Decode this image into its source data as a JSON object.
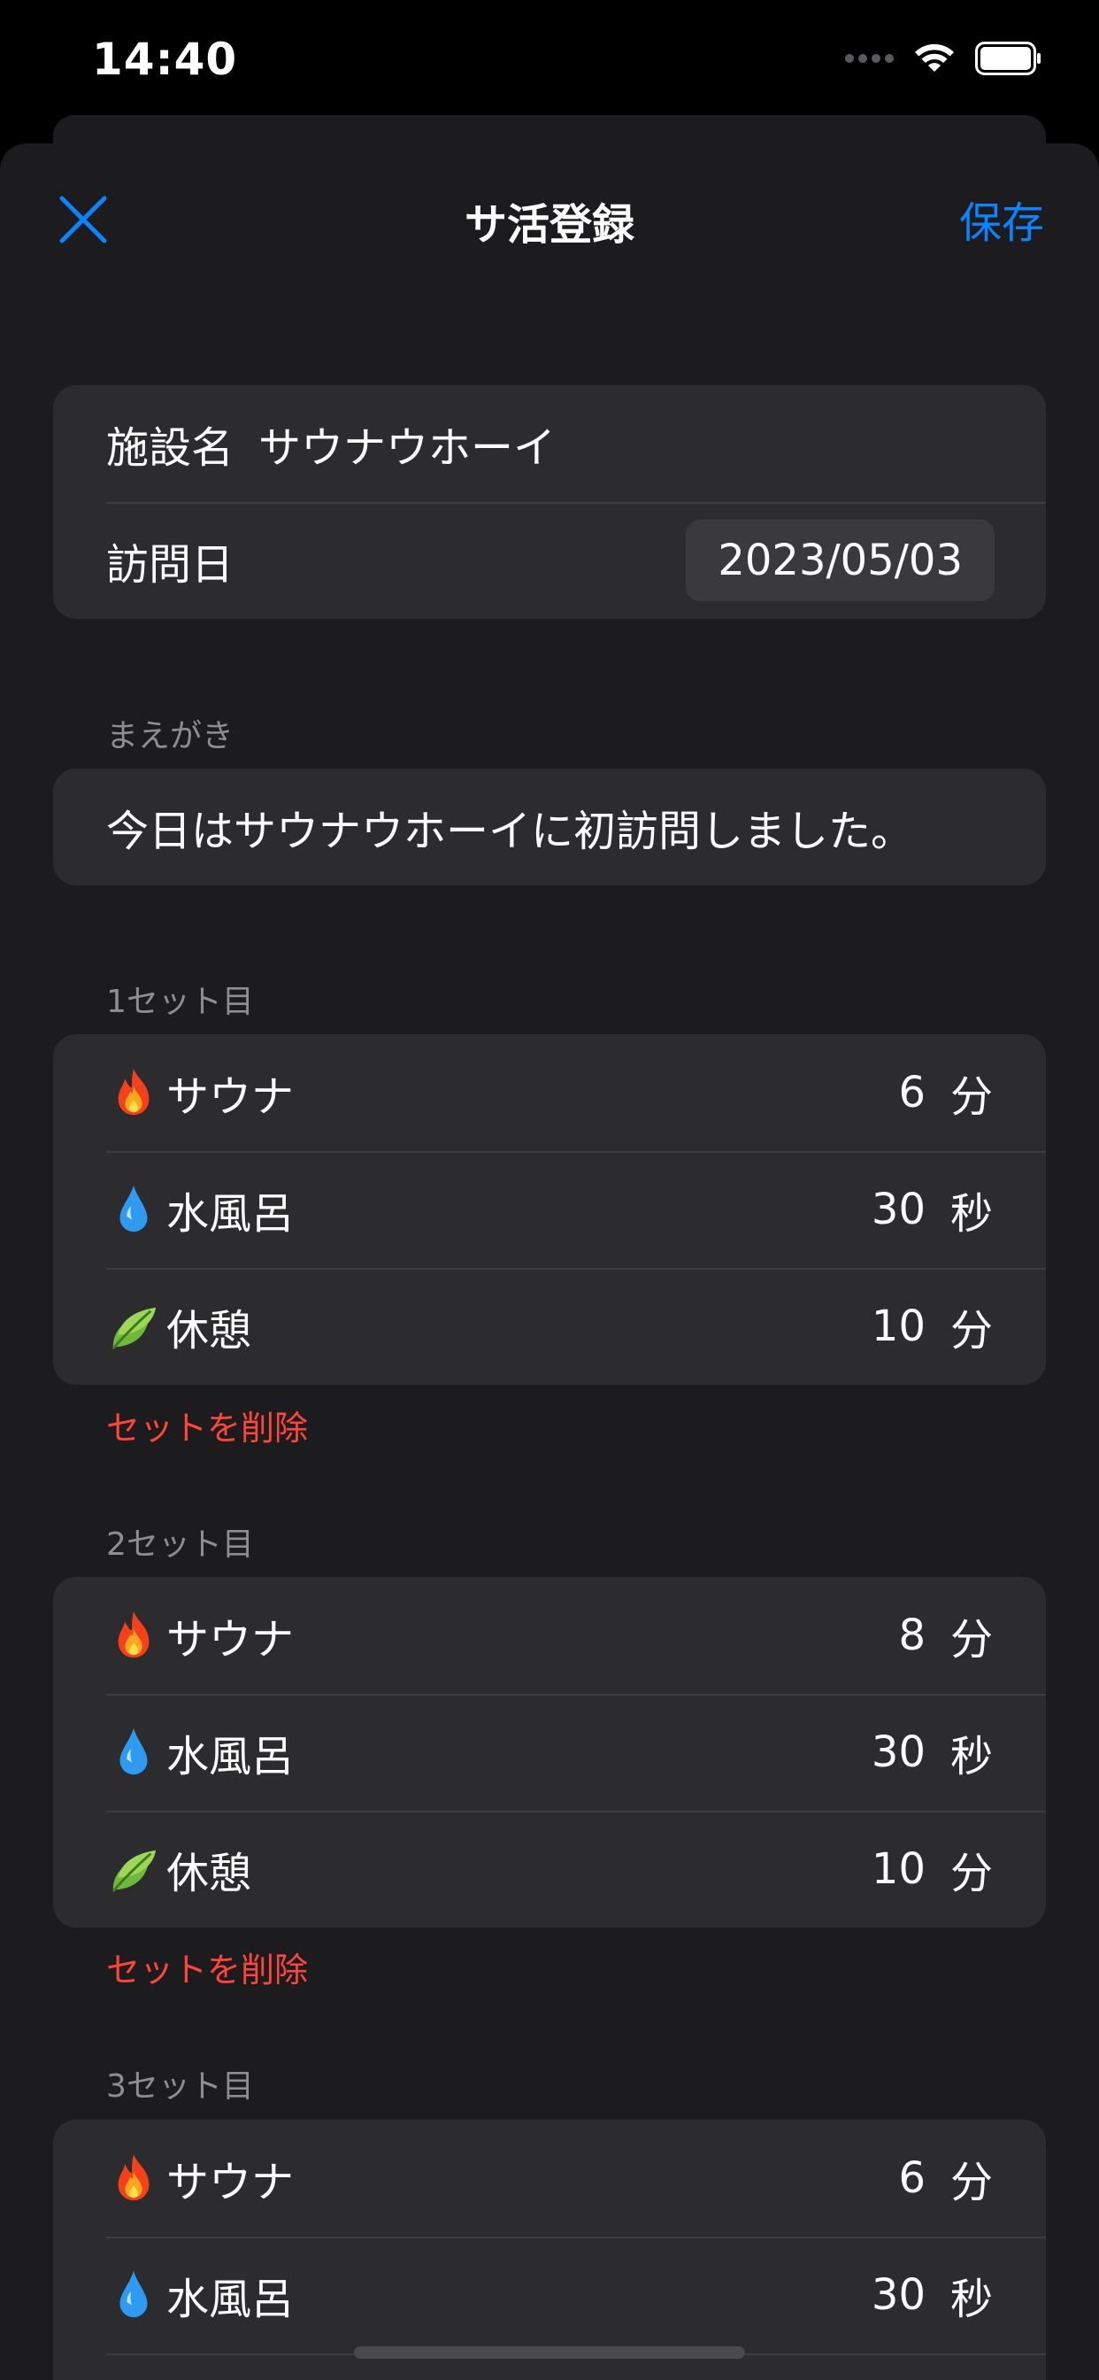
{
  "status_bar": {
    "time": "14:40"
  },
  "nav": {
    "title": "サ活登録",
    "close_icon": "close-icon",
    "save_label": "保存"
  },
  "facility": {
    "name_label": "施設名",
    "name_value": "サウナウホーイ",
    "date_label": "訪問日",
    "date_value": "2023/05/03"
  },
  "preface": {
    "header": "まえがき",
    "text": "今日はサウナウホーイに初訪問しました。"
  },
  "sets": [
    {
      "header": "1セット目",
      "items": [
        {
          "icon": "fire-icon",
          "name": "サウナ",
          "value": "6",
          "unit": "分"
        },
        {
          "icon": "water-drop-icon",
          "name": "水風呂",
          "value": "30",
          "unit": "秒"
        },
        {
          "icon": "leaf-icon",
          "name": "休憩",
          "value": "10",
          "unit": "分"
        }
      ],
      "delete_label": "セットを削除"
    },
    {
      "header": "2セット目",
      "items": [
        {
          "icon": "fire-icon",
          "name": "サウナ",
          "value": "8",
          "unit": "分"
        },
        {
          "icon": "water-drop-icon",
          "name": "水風呂",
          "value": "30",
          "unit": "秒"
        },
        {
          "icon": "leaf-icon",
          "name": "休憩",
          "value": "10",
          "unit": "分"
        }
      ],
      "delete_label": "セットを削除"
    },
    {
      "header": "3セット目",
      "items": [
        {
          "icon": "fire-icon",
          "name": "サウナ",
          "value": "6",
          "unit": "分"
        },
        {
          "icon": "water-drop-icon",
          "name": "水風呂",
          "value": "30",
          "unit": "秒"
        }
      ]
    }
  ],
  "colors": {
    "accent": "#0a84ff",
    "destructive": "#ff453a",
    "sheet_background": "#1c1c1e",
    "group_background": "#2c2c2e"
  }
}
